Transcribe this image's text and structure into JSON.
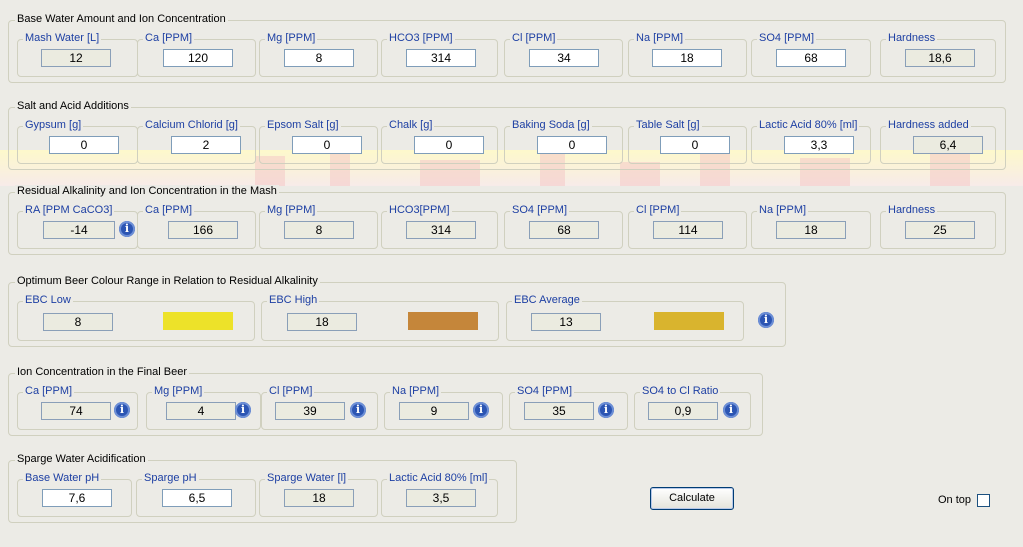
{
  "base": {
    "title": "Base Water Amount and Ion Concentration",
    "fields": [
      {
        "label": "Mash Water [L]",
        "value": "12",
        "ro": true
      },
      {
        "label": "Ca [PPM]",
        "value": "120",
        "ro": false
      },
      {
        "label": "Mg [PPM]",
        "value": "8",
        "ro": false
      },
      {
        "label": "HCO3 [PPM]",
        "value": "314",
        "ro": false
      },
      {
        "label": "Cl [PPM]",
        "value": "34",
        "ro": false
      },
      {
        "label": "Na [PPM]",
        "value": "18",
        "ro": false
      },
      {
        "label": "SO4 [PPM]",
        "value": "68",
        "ro": false
      },
      {
        "label": "Hardness",
        "value": "18,6",
        "ro": true
      }
    ]
  },
  "salt": {
    "title": "Salt and Acid Additions",
    "fields": [
      {
        "label": "Gypsum [g]",
        "value": "0",
        "ro": false
      },
      {
        "label": "Calcium Chlorid [g]",
        "value": "2",
        "ro": false
      },
      {
        "label": "Epsom Salt [g]",
        "value": "0",
        "ro": false
      },
      {
        "label": "Chalk [g]",
        "value": "0",
        "ro": false
      },
      {
        "label": "Baking Soda [g]",
        "value": "0",
        "ro": false
      },
      {
        "label": "Table Salt [g]",
        "value": "0",
        "ro": false
      },
      {
        "label": "Lactic Acid 80% [ml]",
        "value": "3,3",
        "ro": false
      },
      {
        "label": "Hardness added",
        "value": "6,4",
        "ro": true
      }
    ]
  },
  "residual": {
    "title": "Residual Alkalinity and Ion Concentration in the Mash",
    "fields": [
      {
        "label": "RA [PPM CaCO3]",
        "value": "-14",
        "ro": true,
        "info": true
      },
      {
        "label": "Ca [PPM]",
        "value": "166",
        "ro": true
      },
      {
        "label": "Mg [PPM]",
        "value": "8",
        "ro": true
      },
      {
        "label": "HCO3[PPM]",
        "value": "314",
        "ro": true
      },
      {
        "label": "SO4 [PPM]",
        "value": "68",
        "ro": true
      },
      {
        "label": "Cl [PPM]",
        "value": "114",
        "ro": true
      },
      {
        "label": "Na [PPM]",
        "value": "18",
        "ro": true
      },
      {
        "label": "Hardness",
        "value": "25",
        "ro": true
      }
    ]
  },
  "colour": {
    "title": "Optimum Beer Colour Range in Relation to Residual Alkalinity",
    "fields": [
      {
        "label": "EBC Low",
        "value": "8",
        "color": "#ede229"
      },
      {
        "label": "EBC High",
        "value": "18",
        "color": "#c5863a"
      },
      {
        "label": "EBC Average",
        "value": "13",
        "color": "#d9b42e"
      }
    ]
  },
  "finalbeer": {
    "title": "Ion Concentration in the Final Beer",
    "fields": [
      {
        "label": "Ca [PPM]",
        "value": "74"
      },
      {
        "label": "Mg [PPM]",
        "value": "4"
      },
      {
        "label": "Cl [PPM]",
        "value": "39"
      },
      {
        "label": "Na [PPM]",
        "value": "9"
      },
      {
        "label": "SO4 [PPM]",
        "value": "35"
      },
      {
        "label": "SO4 to Cl Ratio",
        "value": "0,9"
      }
    ]
  },
  "sparge": {
    "title": "Sparge Water Acidification",
    "fields": [
      {
        "label": "Base Water pH",
        "value": "7,6",
        "ro": false
      },
      {
        "label": "Sparge pH",
        "value": "6,5",
        "ro": false
      },
      {
        "label": "Sparge Water [l]",
        "value": "18",
        "ro": true
      },
      {
        "label": "Lactic Acid 80% [ml]",
        "value": "3,5",
        "ro": true
      }
    ]
  },
  "actions": {
    "calculate": "Calculate",
    "ontop": "On top",
    "ontop_checked": false
  },
  "icons": {
    "info": "info-icon",
    "info_glyph": "i"
  }
}
